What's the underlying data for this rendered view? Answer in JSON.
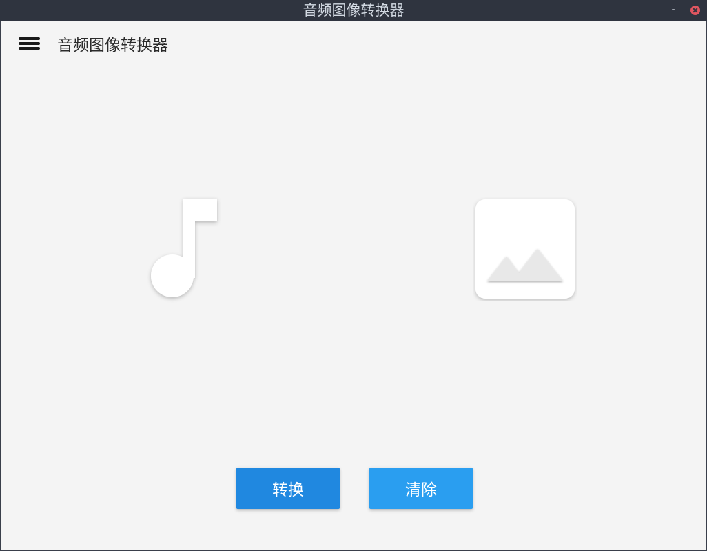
{
  "window": {
    "title": "音频图像转换器",
    "minimize_label": "-"
  },
  "header": {
    "menu_icon": "hamburger-menu-icon",
    "title": "音频图像转换器"
  },
  "panels": {
    "audio_icon": "music-note-icon",
    "image_icon": "image-icon"
  },
  "buttons": {
    "convert_label": "转换",
    "clear_label": "清除"
  },
  "colors": {
    "titlebar_bg": "#2f343f",
    "background": "#f4f4f4",
    "convert_button": "#2088e0",
    "clear_button": "#2a9ef0",
    "close_button": "#e05660"
  }
}
